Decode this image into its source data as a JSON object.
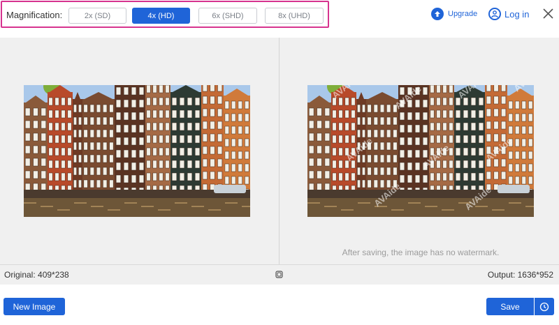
{
  "header": {
    "magnification_label": "Magnification:",
    "options": [
      {
        "label": "2x (SD)",
        "selected": false
      },
      {
        "label": "4x (HD)",
        "selected": true
      },
      {
        "label": "6x (SHD)",
        "selected": false
      },
      {
        "label": "8x (UHD)",
        "selected": false
      }
    ],
    "upgrade_label": "Upgrade",
    "login_label": "Log in"
  },
  "preview": {
    "output_note": "After saving, the image has no watermark.",
    "watermark_text": "AVAide"
  },
  "info": {
    "original": "Original: 409*238",
    "output": "Output: 1636*952"
  },
  "footer": {
    "new_image_label": "New Image",
    "save_label": "Save"
  },
  "colors": {
    "accent": "#1f64d8",
    "highlight_border": "#d6338f"
  },
  "icons": {
    "upgrade": "arrow-up-circle-icon",
    "login": "user-circle-icon",
    "close": "close-icon",
    "compare": "compare-icon",
    "history": "clock-icon"
  }
}
